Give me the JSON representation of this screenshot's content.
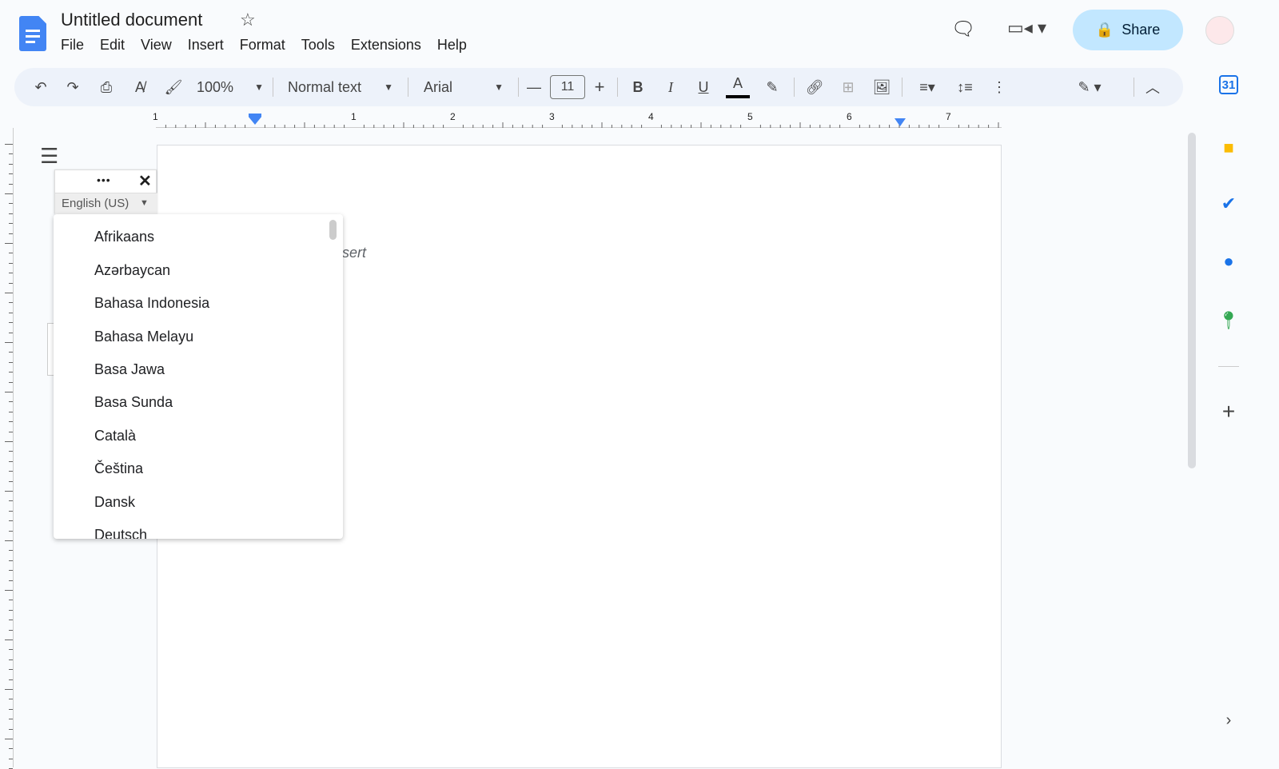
{
  "header": {
    "title": "Untitled document",
    "menu": [
      "File",
      "Edit",
      "View",
      "Insert",
      "Format",
      "Tools",
      "Extensions",
      "Help"
    ],
    "share_label": "Share"
  },
  "toolbar": {
    "zoom": "100%",
    "style": "Normal text",
    "font": "Arial",
    "font_size": "11"
  },
  "ruler": {
    "labels": [
      "1",
      "1",
      "2",
      "3",
      "4",
      "5",
      "6",
      "7"
    ]
  },
  "document": {
    "hint_text": "sert"
  },
  "language_widget": {
    "selected": "English (US)",
    "options": [
      "Afrikaans",
      "Azərbaycan",
      "Bahasa Indonesia",
      "Bahasa Melayu",
      "Basa Jawa",
      "Basa Sunda",
      "Català",
      "Čeština",
      "Dansk",
      "Deutsch"
    ]
  },
  "colors": {
    "accent": "#0b57d0",
    "share_bg": "#c2e7ff",
    "toolbar_bg": "#edf2fa"
  }
}
